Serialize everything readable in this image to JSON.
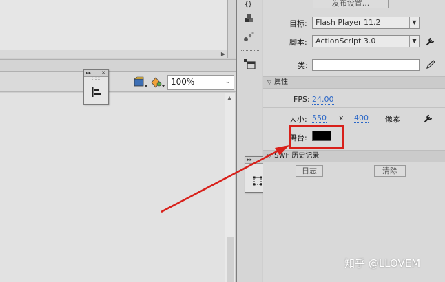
{
  "window": {
    "zoom": "100%"
  },
  "properties": {
    "publish_settings_label": "发布设置...",
    "target_label": "目标:",
    "target_value": "Flash Player 11.2",
    "script_label": "脚本:",
    "script_value": "ActionScript 3.0",
    "class_label": "类:",
    "class_value": "",
    "properties_section": "属性",
    "fps_label": "FPS:",
    "fps_value": "24.00",
    "size_label": "大小:",
    "width_value": "550",
    "times": "x",
    "height_value": "400",
    "pixels_label": "像素",
    "stage_label": "舞台:",
    "stage_color": "#000000",
    "swf_history_section": "SWF 历史记录",
    "log_button": "日志",
    "clear_button": "清除"
  },
  "colors": {
    "annotation": "#d8201a",
    "link": "#2b67c7"
  },
  "watermark": "知乎 @LLOVEM"
}
